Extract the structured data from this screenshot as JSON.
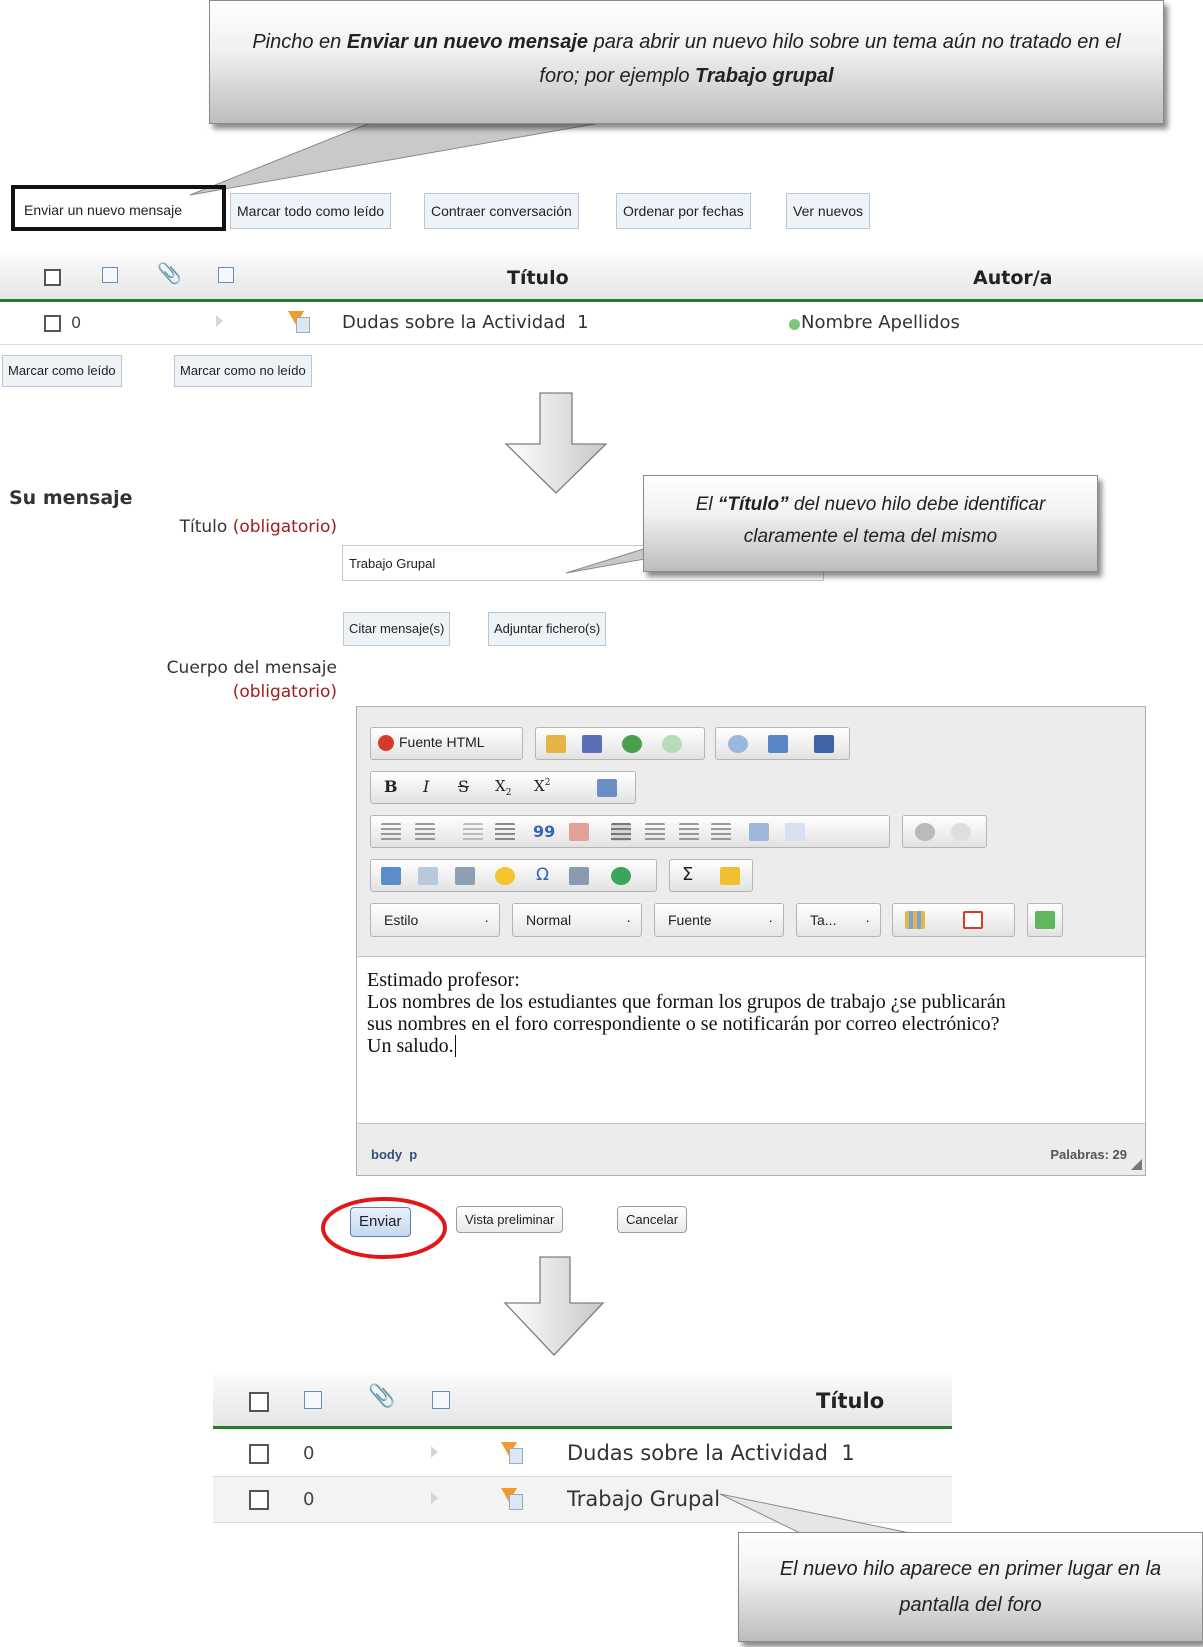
{
  "callouts": {
    "top": {
      "before": "Pincho en ",
      "bold": "Enviar un nuevo mensaje",
      "middle": " para abrir un nuevo hilo sobre un tema aún no tratado en el foro; por ejemplo ",
      "bold2": "Trabajo grupal"
    },
    "title": {
      "before": "El ",
      "bold": "“Título”",
      "after": " del nuevo hilo debe identificar claramente el tema del mismo"
    },
    "bottom": {
      "text": "El nuevo hilo aparece en primer lugar en la pantalla del foro"
    }
  },
  "forum_toolbar": [
    "Enviar un nuevo mensaje",
    "Marcar todo como leído",
    "Contraer conversación",
    "Ordenar por fechas",
    "Ver nuevos"
  ],
  "table": {
    "header_title": "Título",
    "header_author": "Autor/a",
    "rows": [
      {
        "count": "0",
        "title": "Dudas sobre la Actividad  1",
        "author": "Nombre Apellidos"
      }
    ]
  },
  "mark_buttons": [
    "Marcar como leído",
    "Marcar como no leído"
  ],
  "form": {
    "heading": "Su mensaje",
    "title_label": "Título",
    "required": "(obligatorio)",
    "title_value": "Trabajo Grupal",
    "attach_buttons": [
      "Citar mensaje(s)",
      "Adjuntar fichero(s)"
    ],
    "body_label": "Cuerpo del mensaje",
    "body_required": "(obligatorio)"
  },
  "editor": {
    "source_button": "Fuente HTML",
    "bold": "B",
    "italic": "I",
    "strike": "S",
    "subscript": "X",
    "sub_mark": "2",
    "superscript": "X",
    "sup_mark": "2",
    "quote_mark": "99",
    "omega": "Ω",
    "sigma": "Σ",
    "combos": [
      "Estilo",
      "Normal",
      "Fuente",
      "Ta..."
    ],
    "combo_arrow": "·",
    "body_lines": [
      "Estimado profesor:",
      "Los nombres de los estudiantes que forman los grupos de trabajo ¿se publicarán",
      "sus nombres en el foro correspondiente o se notificarán por correo electrónico?",
      "Un saludo."
    ],
    "path": [
      "body",
      "p"
    ],
    "word_count": "Palabras: 29"
  },
  "submit_buttons": [
    "Enviar",
    "Vista preliminar",
    "Cancelar"
  ],
  "result_table": {
    "header_title": "Título",
    "rows": [
      {
        "count": "0",
        "title": "Dudas sobre la Actividad  1"
      },
      {
        "count": "0",
        "title": "Trabajo Grupal"
      }
    ]
  },
  "colors": {
    "accent_green": "#2a7a2e",
    "required_red": "#a31c1c",
    "highlight_red": "#e01818"
  }
}
